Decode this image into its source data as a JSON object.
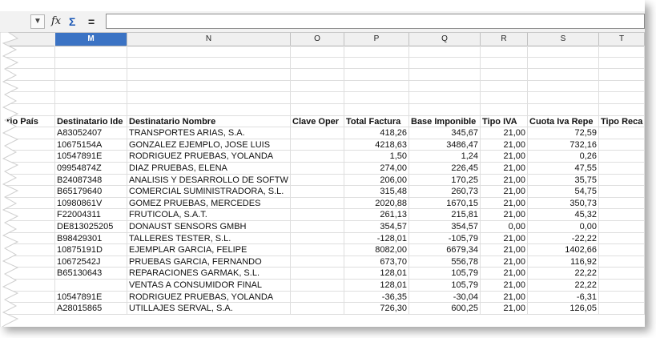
{
  "toolbar": {
    "fx_icon": "fx-icon",
    "sigma_icon": "sigma-icon",
    "equals_label": "=",
    "formula_value": ""
  },
  "columns": [
    {
      "id": "M",
      "selected": true
    },
    {
      "id": "N",
      "selected": false
    },
    {
      "id": "O",
      "selected": false
    },
    {
      "id": "P",
      "selected": false
    },
    {
      "id": "Q",
      "selected": false
    },
    {
      "id": "R",
      "selected": false
    },
    {
      "id": "S",
      "selected": false
    },
    {
      "id": "T",
      "selected": false
    }
  ],
  "table": {
    "headers": [
      "ario País",
      "Destinatario Ide",
      "Destinatario Nombre",
      "Clave Oper",
      "Total Factura",
      "Base Imponible",
      "Tipo IVA",
      "Cuota Iva Repe",
      "Tipo Reca"
    ],
    "rows": [
      [
        "",
        "A83052407",
        "TRANSPORTES ARIAS, S.A.",
        "",
        "418,26",
        "345,67",
        "21,00",
        "72,59",
        ""
      ],
      [
        "",
        "10675154A",
        "GONZALEZ EJEMPLO, JOSE LUIS",
        "",
        "4218,63",
        "3486,47",
        "21,00",
        "732,16",
        ""
      ],
      [
        "",
        "10547891E",
        "RODRIGUEZ PRUEBAS, YOLANDA",
        "",
        "1,50",
        "1,24",
        "21,00",
        "0,26",
        ""
      ],
      [
        "",
        "09954874Z",
        "DIAZ PRUEBAS, ELENA",
        "",
        "274,00",
        "226,45",
        "21,00",
        "47,55",
        ""
      ],
      [
        "",
        "B24087348",
        "ANALISIS Y DESARROLLO DE SOFTW",
        "",
        "206,00",
        "170,25",
        "21,00",
        "35,75",
        ""
      ],
      [
        "",
        "B65179640",
        "COMERCIAL SUMINISTRADORA, S.L.",
        "",
        "315,48",
        "260,73",
        "21,00",
        "54,75",
        ""
      ],
      [
        "",
        "10980861V",
        "GOMEZ PRUEBAS, MERCEDES",
        "",
        "2020,88",
        "1670,15",
        "21,00",
        "350,73",
        ""
      ],
      [
        "",
        "F22004311",
        "FRUTICOLA, S.A.T.",
        "",
        "261,13",
        "215,81",
        "21,00",
        "45,32",
        ""
      ],
      [
        "",
        "DE813025205",
        "DONAUST SENSORS GMBH",
        "",
        "354,57",
        "354,57",
        "0,00",
        "0,00",
        ""
      ],
      [
        "",
        "B98429301",
        "TALLERES TESTER, S.L.",
        "",
        "-128,01",
        "-105,79",
        "21,00",
        "-22,22",
        ""
      ],
      [
        "",
        "10875191D",
        "EJEMPLAR GARCIA, FELIPE",
        "",
        "8082,00",
        "6679,34",
        "21,00",
        "1402,66",
        ""
      ],
      [
        "",
        "10672542J",
        "PRUEBAS GARCIA, FERNANDO",
        "",
        "673,70",
        "556,78",
        "21,00",
        "116,92",
        ""
      ],
      [
        "",
        "B65130643",
        "REPARACIONES GARMAK, S.L.",
        "",
        "128,01",
        "105,79",
        "21,00",
        "22,22",
        ""
      ],
      [
        "",
        "",
        "VENTAS A CONSUMIDOR FINAL",
        "",
        "128,01",
        "105,79",
        "21,00",
        "22,22",
        ""
      ],
      [
        "",
        "10547891E",
        "RODRIGUEZ PRUEBAS, YOLANDA",
        "",
        "-36,35",
        "-30,04",
        "21,00",
        "-6,31",
        ""
      ],
      [
        "",
        "A28015865",
        "UTILLAJES SERVAL, S.A.",
        "",
        "726,30",
        "600,25",
        "21,00",
        "126,05",
        ""
      ]
    ]
  }
}
